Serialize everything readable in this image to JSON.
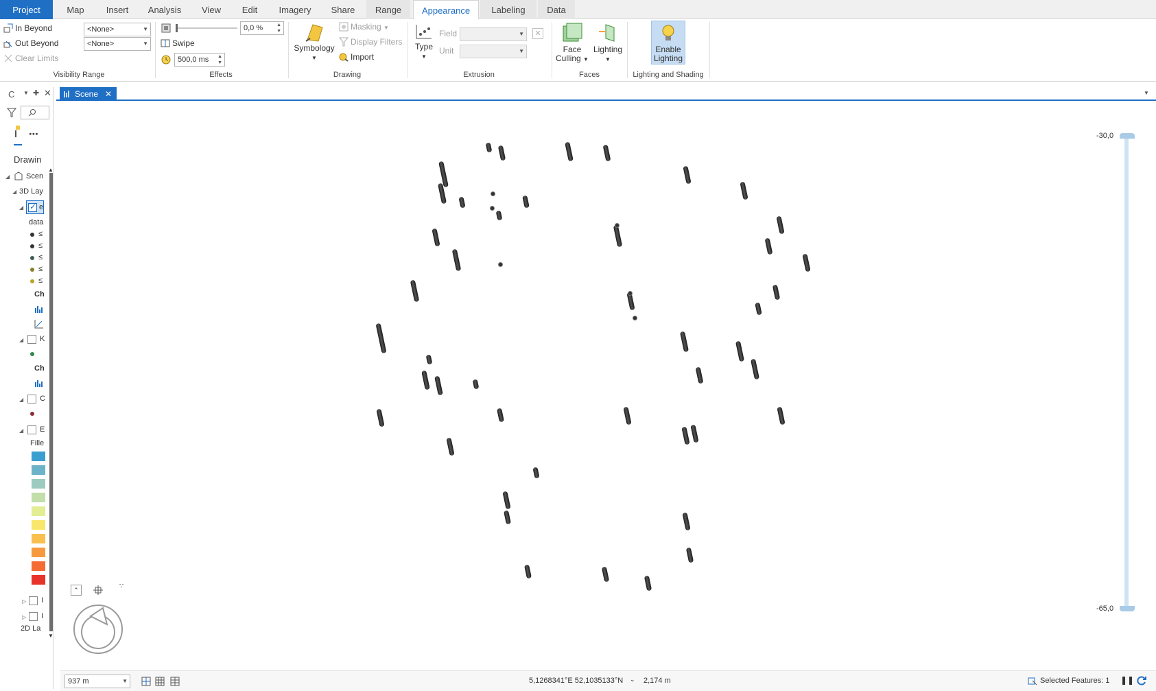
{
  "ribbon_tabs": [
    {
      "label": "Project"
    },
    {
      "label": "Map"
    },
    {
      "label": "Insert"
    },
    {
      "label": "Analysis"
    },
    {
      "label": "View"
    },
    {
      "label": "Edit"
    },
    {
      "label": "Imagery"
    },
    {
      "label": "Share"
    },
    {
      "label": "Range"
    },
    {
      "label": "Appearance"
    },
    {
      "label": "Labeling"
    },
    {
      "label": "Data"
    }
  ],
  "visibility_range": {
    "in_beyond": "In Beyond",
    "out_beyond": "Out Beyond",
    "clear_limits": "Clear Limits",
    "in_value": "<None>",
    "out_value": "<None>",
    "title": "Visibility Range"
  },
  "effects": {
    "transparency": "0,0 %",
    "swipe": "Swipe",
    "flicker": "500,0 ms",
    "title": "Effects"
  },
  "drawing": {
    "symbology": "Symbology",
    "masking": "Masking",
    "display_filters": "Display Filters",
    "import": "Import",
    "title": "Drawing"
  },
  "extrusion": {
    "type": "Type",
    "field": "Field",
    "unit": "Unit",
    "title": "Extrusion"
  },
  "faces": {
    "face_culling_1": "Face",
    "face_culling_2": "Culling",
    "lighting": "Lighting",
    "title": "Faces"
  },
  "lighting_shading": {
    "enable_1": "Enable",
    "enable_2": "Lighting",
    "title": "Lighting and Shading"
  },
  "contents_pane": {
    "title": "C",
    "section": "Drawin",
    "scene_item": "Scen",
    "layers_item": "3D Lay",
    "layer_e": "e",
    "layer_field": "data",
    "legend_lte": "≤",
    "chart_label": "Ch",
    "layer_k": "K",
    "chart_label_2": "Ch",
    "layer_c": "C",
    "layer_b": "E",
    "fill_label": "Fille",
    "layer_i1": "I",
    "layer_i2": "I",
    "footer": "2D La"
  },
  "colors": {
    "accent": "#1f6fc5",
    "swatches": [
      "#3a9fd0",
      "#6ab3c9",
      "#9ecbbf",
      "#c2deaa",
      "#e3ed93",
      "#f8e76a",
      "#f9c04f",
      "#f79a3f",
      "#f46c34",
      "#e8332a"
    ],
    "legend_dots": [
      "#333333",
      "#333333",
      "#3d5c56",
      "#8a7f2c",
      "#b8a32a"
    ]
  },
  "scene_tab": {
    "label": "Scene"
  },
  "elevation": {
    "top": "-30,0",
    "bottom": "-65,0"
  },
  "status_bar": {
    "scale": "937 m",
    "coords": "5,1268341°E 52,1035133°N",
    "elevation": "2,174 m",
    "selected": "Selected Features: 1"
  }
}
